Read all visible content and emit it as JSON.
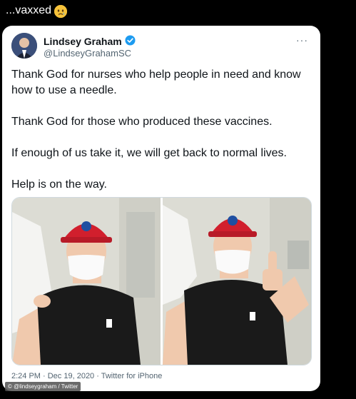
{
  "post": {
    "caption": "...vaxxed",
    "emoji": "crying-face"
  },
  "tweet": {
    "author_name": "Lindsey Graham",
    "author_handle": "@LindseyGrahamSC",
    "verified": true,
    "more_label": "···",
    "paragraphs": [
      "Thank God for nurses who help people in need and know how to use a needle.",
      "Thank God for those who produced these vaccines.",
      "If enough of us take it, we will get back to normal lives.",
      "Help is on the way."
    ],
    "timestamp": "2:24 PM · Dec 19, 2020 · Twitter for iPhone",
    "photos": [
      {
        "description": "man in red cap and mask receiving vaccine shot"
      },
      {
        "description": "man in red cap and mask giving thumbs up"
      }
    ]
  },
  "credit": "© @lindseygraham / Twitter",
  "colors": {
    "background": "#000000",
    "card": "#ffffff",
    "text": "#0f1419",
    "muted": "#536471",
    "verified": "#1d9bf0",
    "cap": "#d11f2d"
  }
}
